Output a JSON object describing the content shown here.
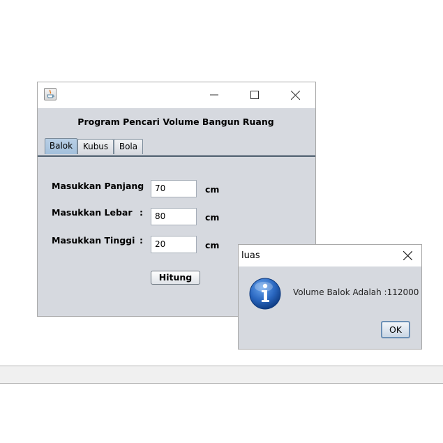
{
  "main_window": {
    "title": "",
    "app_title": "Program Pencari Volume Bangun Ruang",
    "tabs": [
      {
        "label": "Balok",
        "selected": true
      },
      {
        "label": "Kubus",
        "selected": false
      },
      {
        "label": "Bola",
        "selected": false
      }
    ],
    "fields": [
      {
        "label": "Masukkan Panjang",
        "colon": ":",
        "value": "70",
        "unit": "cm"
      },
      {
        "label": "Masukkan Lebar",
        "colon": ":",
        "value": "80",
        "unit": "cm"
      },
      {
        "label": "Masukkan Tinggi",
        "colon": ":",
        "value": "20",
        "unit": "cm"
      }
    ],
    "button_label": "Hitung",
    "icons": {
      "app": "java-icon",
      "minimize": "minimize-icon",
      "maximize": "maximize-icon",
      "close": "close-icon"
    }
  },
  "dialog": {
    "title": "luas",
    "message": "Volume Balok Adalah :112000",
    "ok_label": "OK",
    "icons": {
      "info": "info-icon",
      "close": "close-icon"
    }
  },
  "colors": {
    "panel_bg": "#d6d9df",
    "tab_selected": "#b8cfe5",
    "info_blue": "#1f5fb0"
  }
}
